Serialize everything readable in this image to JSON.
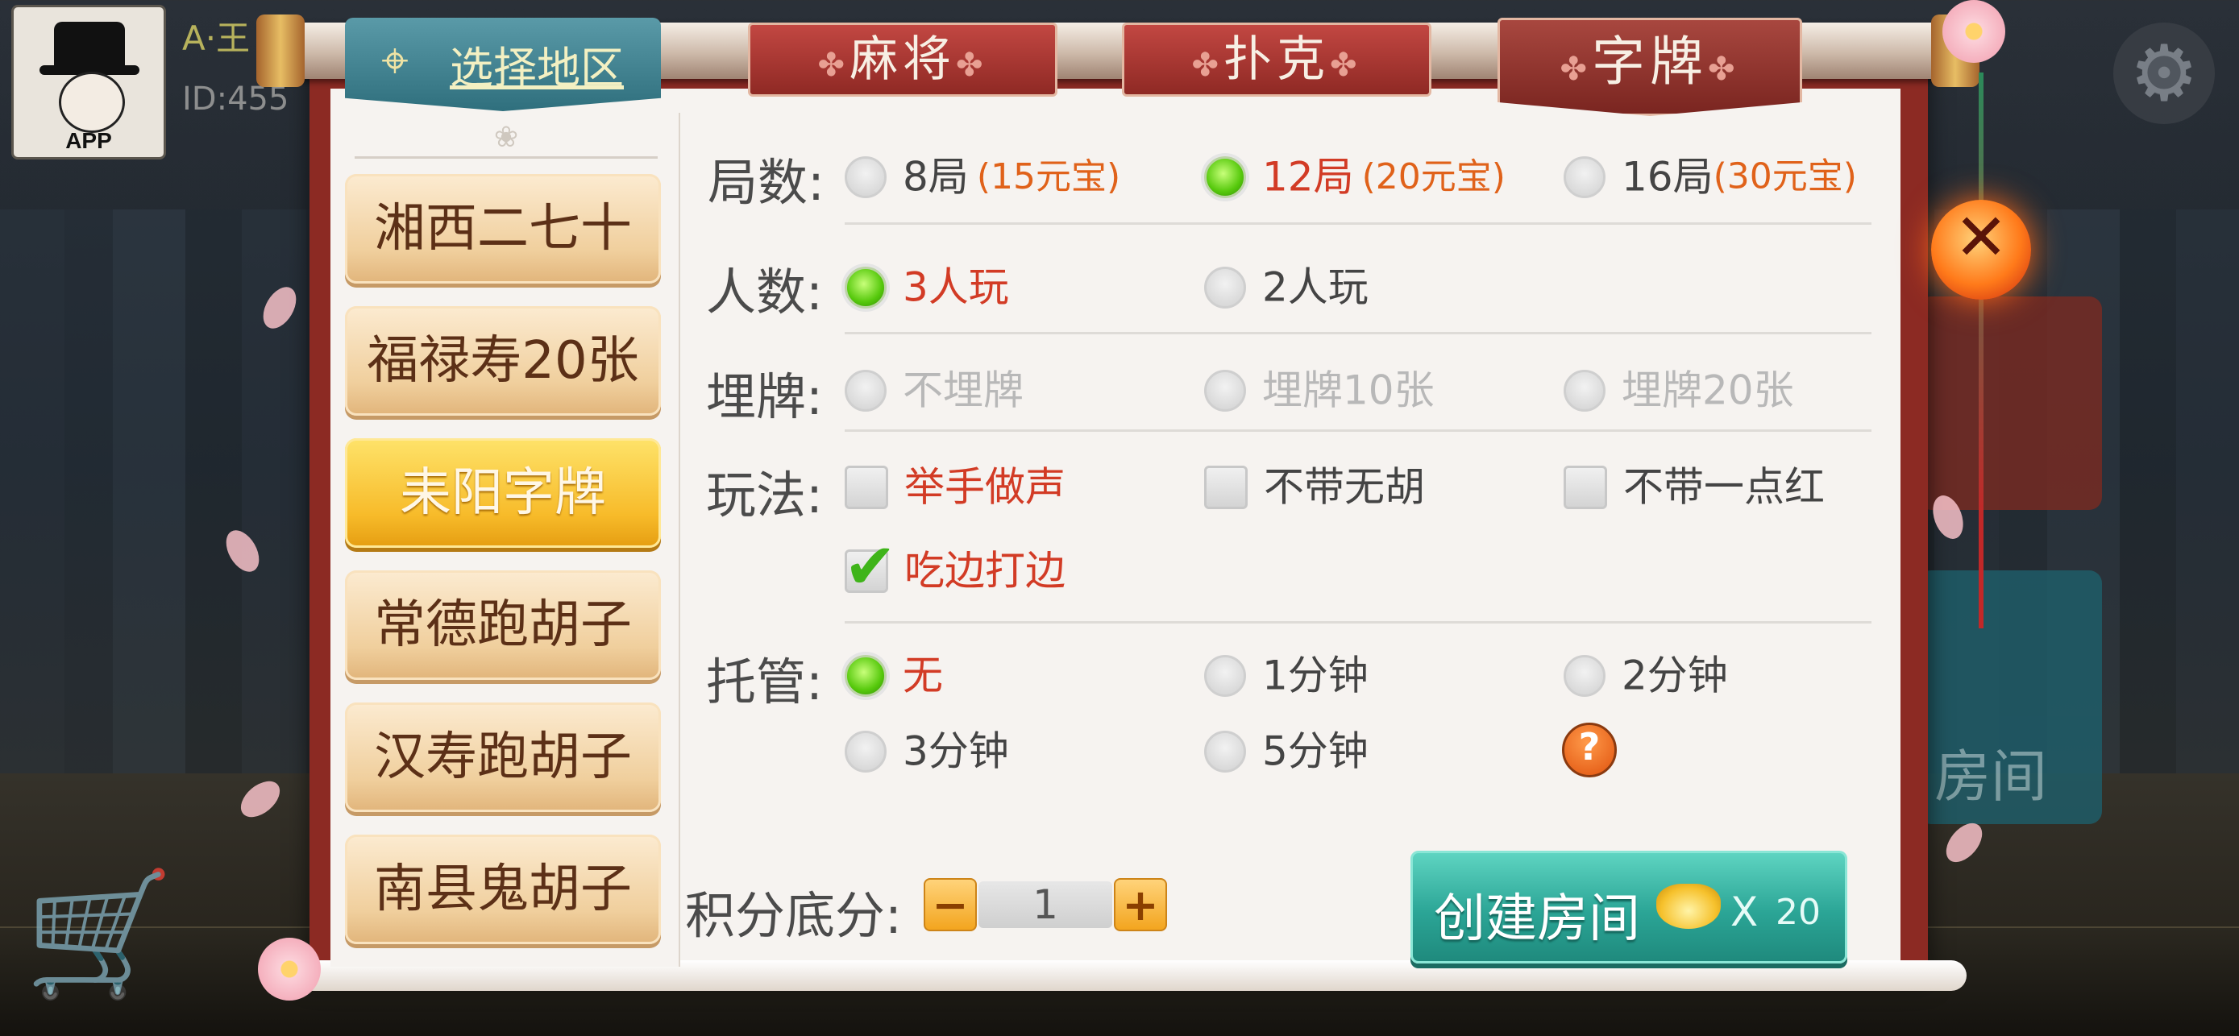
{
  "user": {
    "name": "A·王",
    "id": "ID:455",
    "avatar_text": "APP"
  },
  "tabs": {
    "region": "选择地区",
    "mahjong": "麻将",
    "poker": "扑克",
    "zipai": "字牌",
    "active": "zipai",
    "ornament": "✤"
  },
  "games": [
    {
      "label": "湘西二七十",
      "active": false
    },
    {
      "label": "福禄寿20张",
      "active": false
    },
    {
      "label": "耒阳字牌",
      "active": true
    },
    {
      "label": "常德跑胡子",
      "active": false
    },
    {
      "label": "汉寿跑胡子",
      "active": false
    },
    {
      "label": "南县鬼胡子",
      "active": false
    }
  ],
  "rounds": {
    "label": "局数:",
    "options": [
      {
        "text": "8局",
        "price": "(15元宝)",
        "selected": false
      },
      {
        "text": "12局",
        "price": "(20元宝)",
        "selected": true
      },
      {
        "text": "16局",
        "price": "(30元宝)",
        "selected": false
      }
    ]
  },
  "players": {
    "label": "人数:",
    "options": [
      {
        "text": "3人玩",
        "selected": true
      },
      {
        "text": "2人玩",
        "selected": false
      }
    ]
  },
  "bury": {
    "label": "埋牌:",
    "options": [
      {
        "text": "不埋牌",
        "enabled": false
      },
      {
        "text": "埋牌10张",
        "enabled": false
      },
      {
        "text": "埋牌20张",
        "enabled": false
      }
    ]
  },
  "rules": {
    "label": "玩法:",
    "options": [
      {
        "text": "举手做声",
        "checked": false
      },
      {
        "text": "不带无胡",
        "checked": false
      },
      {
        "text": "不带一点红",
        "checked": false
      },
      {
        "text": "吃边打边",
        "checked": true
      }
    ]
  },
  "auto": {
    "label": "托管:",
    "options": [
      {
        "text": "无",
        "selected": true
      },
      {
        "text": "1分钟",
        "selected": false
      },
      {
        "text": "2分钟",
        "selected": false
      },
      {
        "text": "3分钟",
        "selected": false
      },
      {
        "text": "5分钟",
        "selected": false
      }
    ],
    "help": "?"
  },
  "score": {
    "label": "积分底分:",
    "value": "1",
    "minus": "−",
    "plus": "+"
  },
  "create": {
    "label": "创建房间",
    "x": "X",
    "cost": "20"
  },
  "close": "✕",
  "icons": {
    "location": "location-pin-icon",
    "settings": "gear-icon",
    "close": "close-icon",
    "ingot": "gold-ingot-icon",
    "shop": "shop-cart-icon"
  },
  "colors": {
    "selected_text": "#d23b25",
    "price": "#e0621a",
    "active_game": "#f7bb2a",
    "create_button": "#2ba596",
    "frame": "#8c2a23"
  }
}
